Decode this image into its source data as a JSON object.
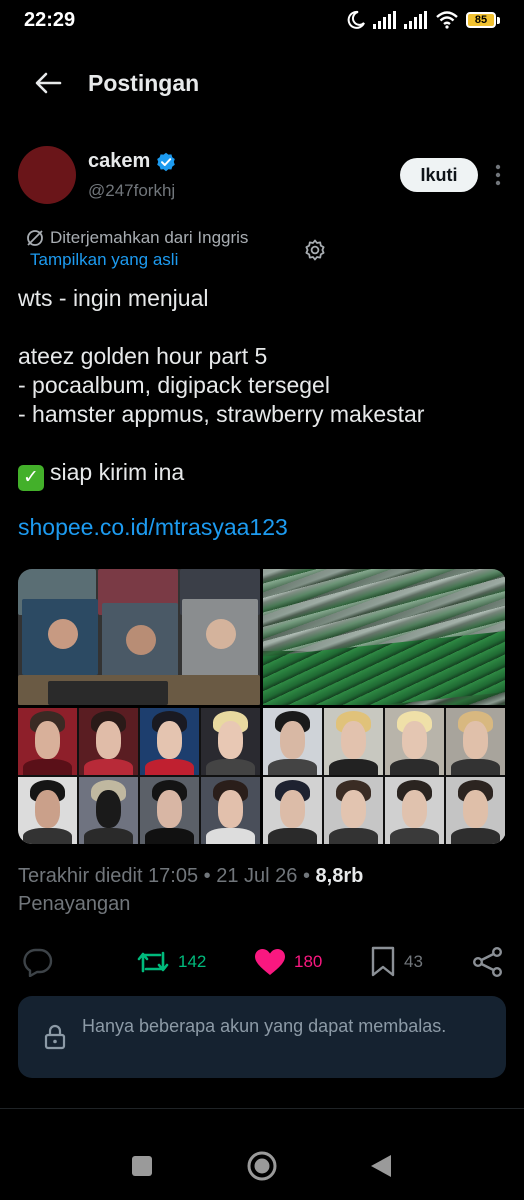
{
  "status_bar": {
    "time": "22:29",
    "battery": "85"
  },
  "header": {
    "title": "Postingan"
  },
  "author": {
    "name": "cakem",
    "handle": "@247forkhj",
    "follow_label": "Ikuti",
    "avatar_color": "#6a1519"
  },
  "translation": {
    "note": "Diterjemahkan dari Inggris",
    "show_original": "Tampilkan yang asli"
  },
  "tweet": {
    "lines": [
      "wts - ingin menjual",
      "ateez golden hour part 5",
      "- pocaalbum, digipack tersegel",
      "- hamster appmus, strawberry makestar",
      "siap kirim ina"
    ],
    "link": "shopee.co.id/mtrasyaa123"
  },
  "media": {
    "count": 4
  },
  "meta": {
    "edited": "Terakhir diedit 17:05 • 21 Jul 26 • ",
    "views_count": "8,8rb",
    "views_label": "Penayangan"
  },
  "actions": {
    "retweets": "142",
    "likes": "180",
    "bookmarks": "43"
  },
  "reply_restriction": {
    "text": "Hanya beberapa akun yang dapat membalas."
  },
  "colors": {
    "accent": "#1d9bf0",
    "retweet": "#00ba7c",
    "like": "#f91880",
    "background": "#000000"
  }
}
